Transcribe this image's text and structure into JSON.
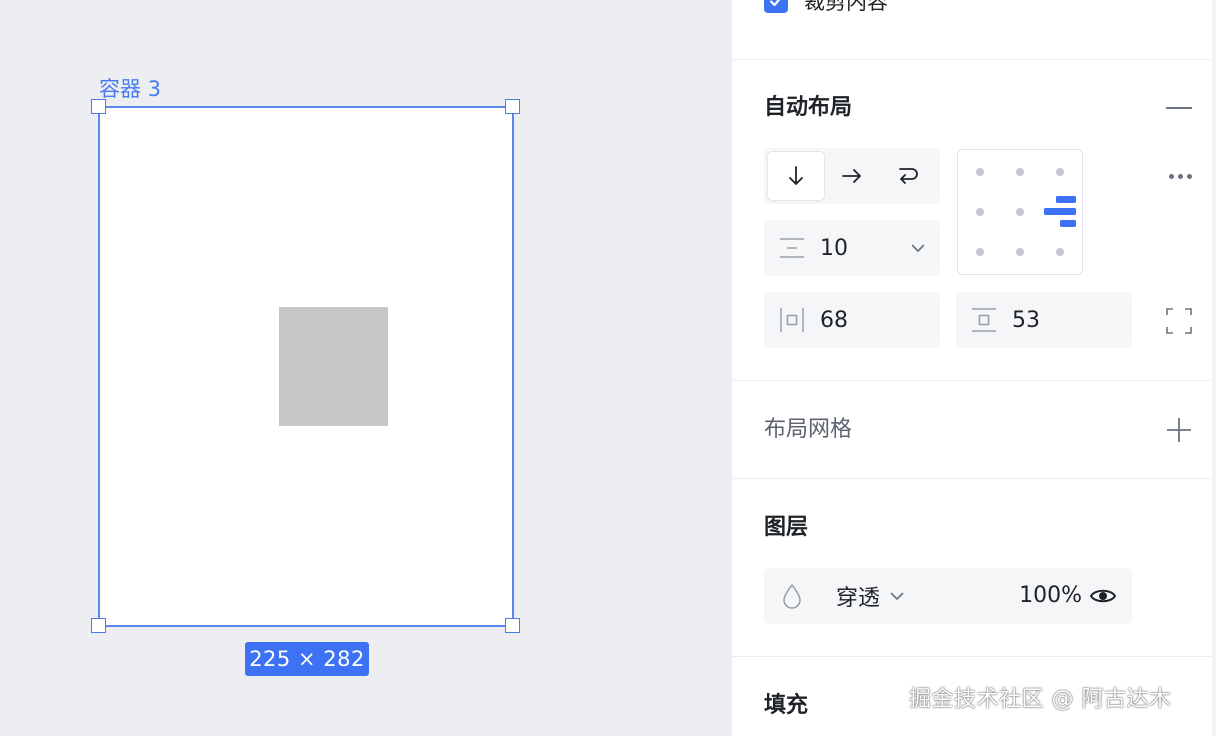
{
  "canvas": {
    "frame_label": "容器 3",
    "size_badge": "225 × 282",
    "selection_color": "#4a7cf0",
    "child_fill": "#c6c6c6"
  },
  "panel": {
    "clip_content": {
      "label": "裁剪内容",
      "checked": true
    },
    "auto_layout": {
      "title": "自动布局",
      "direction_buttons": [
        {
          "name": "vertical",
          "icon": "arrow-down-icon",
          "active": true
        },
        {
          "name": "horizontal",
          "icon": "arrow-right-icon",
          "active": false
        },
        {
          "name": "wrap",
          "icon": "wrap-arrow-icon",
          "active": false
        }
      ],
      "gap_value": "10",
      "horizontal_padding": "68",
      "vertical_padding": "53",
      "alignment": "right-center"
    },
    "layout_grid": {
      "title": "布局网格"
    },
    "layer": {
      "title": "图层",
      "blend_mode": "穿透",
      "opacity": "100%",
      "visible": true
    },
    "fill": {
      "title": "填充"
    }
  },
  "watermark": "掘金技术社区 @ 阿古达木",
  "colors": {
    "accent": "#3d72f5",
    "panel_bg": "#ffffff",
    "canvas_bg": "#eceef1",
    "field_bg": "#f5f6f8"
  }
}
